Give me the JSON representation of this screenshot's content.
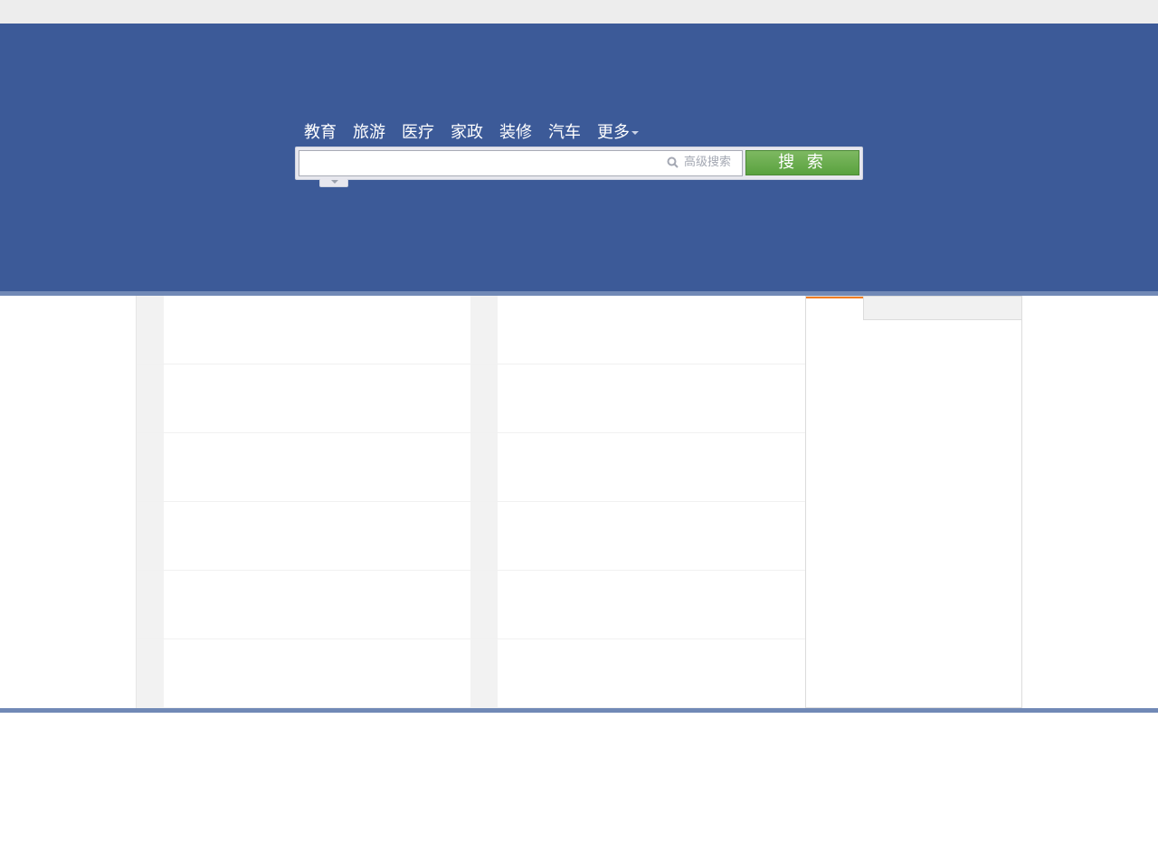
{
  "colors": {
    "header_bg": "#3c5a98",
    "divider": "#7189b6",
    "search_button": "#5aa23f",
    "panel_accent": "#f07d23"
  },
  "nav": {
    "categories": [
      {
        "label": "教育"
      },
      {
        "label": "旅游"
      },
      {
        "label": "医疗"
      },
      {
        "label": "家政"
      },
      {
        "label": "装修"
      },
      {
        "label": "汽车"
      }
    ],
    "more_label": "更多"
  },
  "search": {
    "value": "",
    "advanced_label": "高级搜索",
    "button_label": "搜 索",
    "icon": "search-icon"
  }
}
